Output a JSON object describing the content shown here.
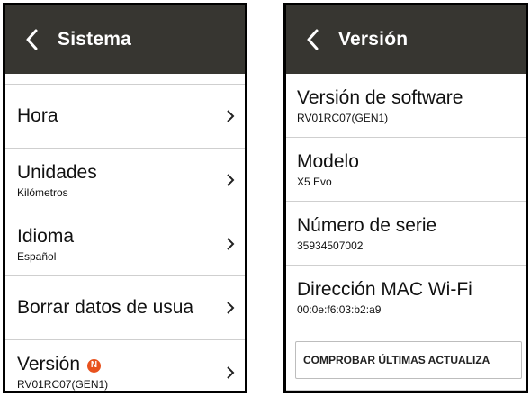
{
  "left_screen": {
    "title": "Sistema",
    "items": [
      {
        "label": "Hora",
        "sub": ""
      },
      {
        "label": "Unidades",
        "sub": "Kilómetros"
      },
      {
        "label": "Idioma",
        "sub": "Español"
      },
      {
        "label": "Borrar datos de usua",
        "sub": ""
      },
      {
        "label": "Versión",
        "sub": "RV01RC07(GEN1)",
        "badge": "N"
      }
    ]
  },
  "right_screen": {
    "title": "Versión",
    "items": [
      {
        "label": "Versión de software",
        "value": "RV01RC07(GEN1)"
      },
      {
        "label": "Modelo",
        "value": "X5 Evo"
      },
      {
        "label": "Número de serie",
        "value": "35934507002"
      },
      {
        "label": "Dirección MAC Wi-Fi",
        "value": "00:0e:f6:03:b2:a9"
      }
    ],
    "update_button_label": "COMPROBAR ÚLTIMAS ACTUALIZA"
  },
  "icons": {
    "back": "chevron-left-icon",
    "row_arrow": "chevron-right-icon",
    "badge": "new-badge-icon"
  },
  "colors": {
    "header_bg": "#373631",
    "badge": "#e8521e",
    "divider": "#cfcfcf"
  }
}
